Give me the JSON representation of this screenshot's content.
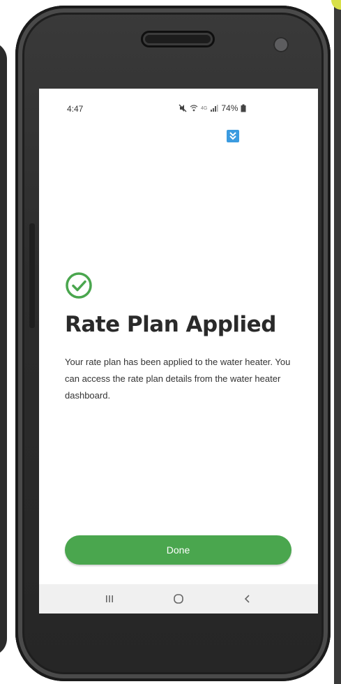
{
  "status_bar": {
    "time": "4:47",
    "battery_percent": "74%",
    "network_label": "4G"
  },
  "icons": {
    "notification_icon": "down-arrow-icon",
    "success_icon": "check-circle-icon",
    "nav_recent": "recent-apps-icon",
    "nav_home": "home-icon",
    "nav_back": "back-icon"
  },
  "content": {
    "title": "Rate Plan Applied",
    "message": "Your rate plan has been applied to the water heater. You can access the rate plan details from the water heater dashboard."
  },
  "actions": {
    "done_label": "Done"
  },
  "colors": {
    "accent": "#4aa64e",
    "notification_badge": "#3b9be0"
  }
}
